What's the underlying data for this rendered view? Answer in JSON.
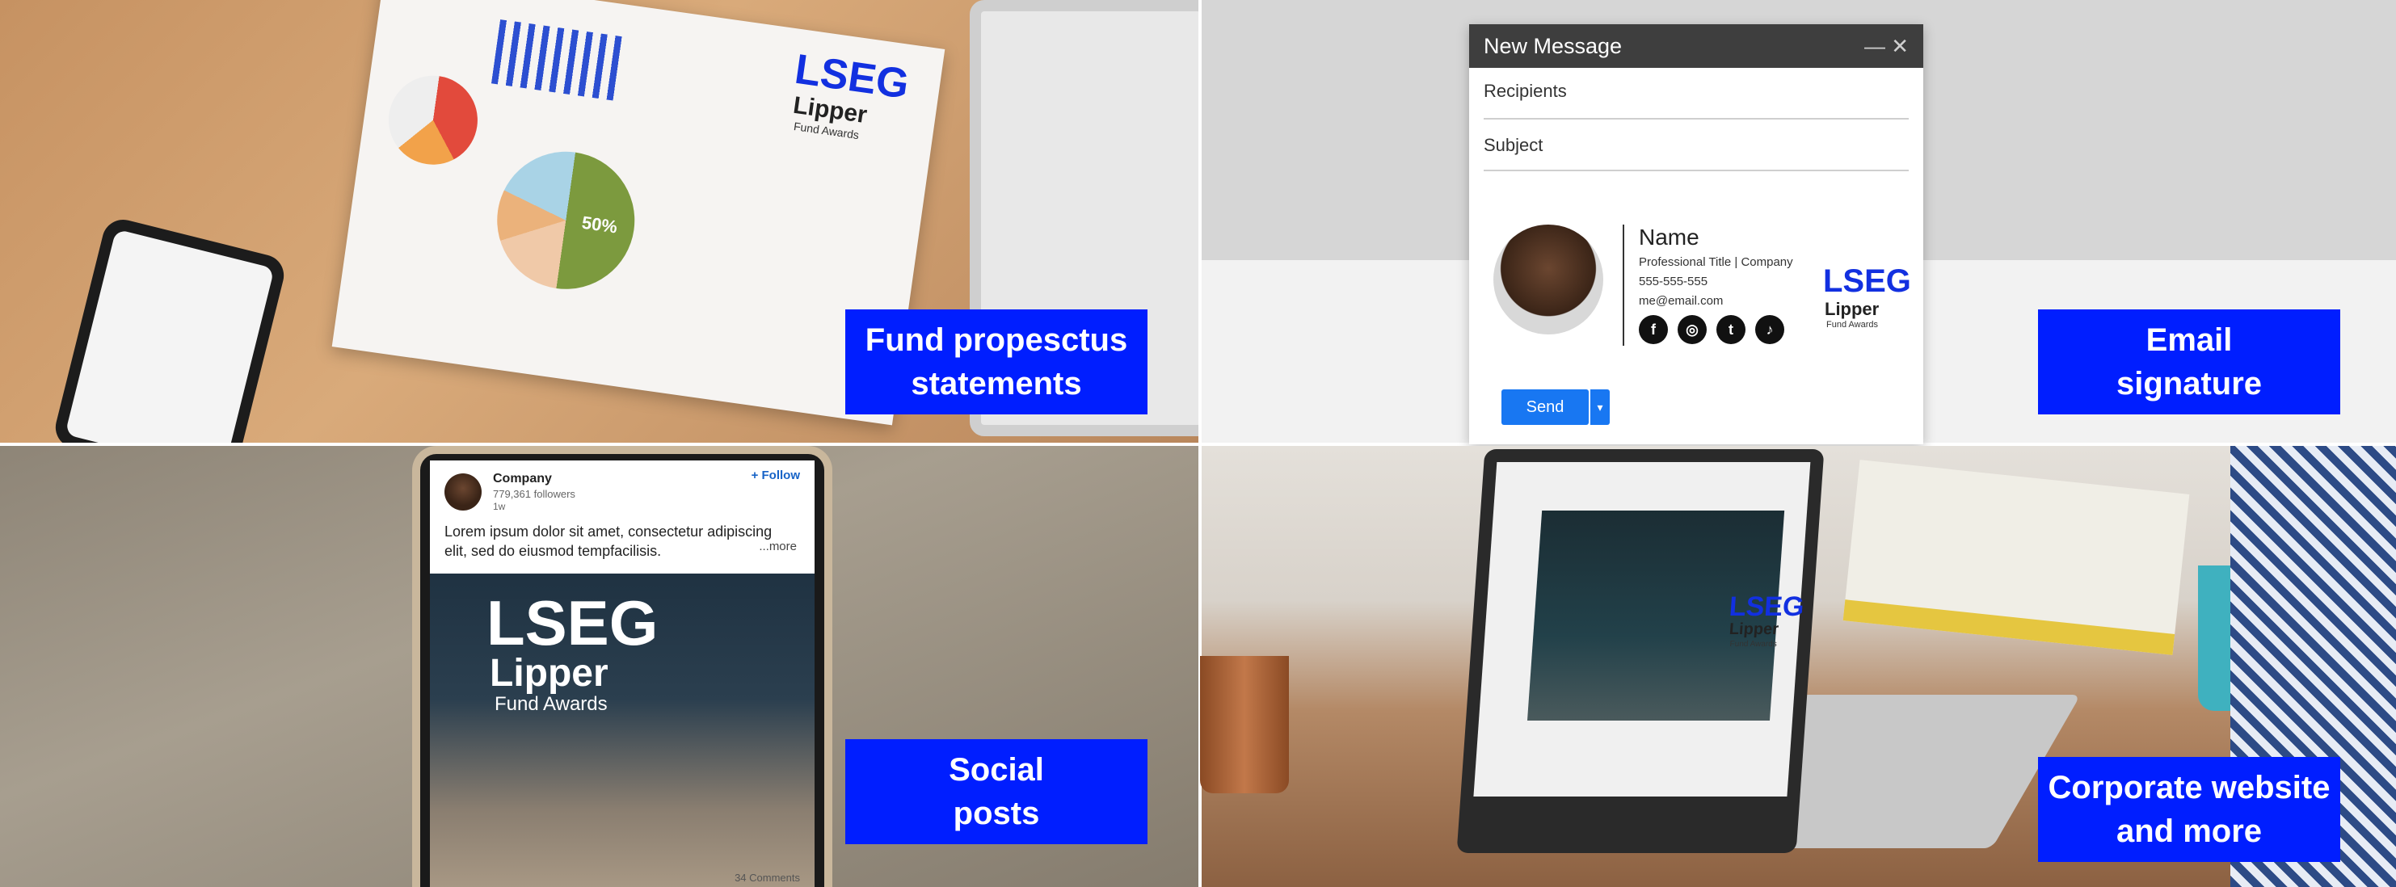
{
  "tiles": {
    "fund": {
      "label_line1": "Fund propesctus",
      "label_line2": "statements",
      "logo": {
        "brand": "LSEG",
        "sub": "Lipper",
        "sub2": "Fund Awards"
      },
      "chart_label": "50%"
    },
    "email": {
      "label_line1": "Email",
      "label_line2": "signature",
      "window_title": "New Message",
      "recipients_label": "Recipients",
      "subject_label": "Subject",
      "signature": {
        "name": "Name",
        "title_line": "Professional Title  |  Company",
        "phone": "555-555-555",
        "email": "me@email.com",
        "social_icons": [
          "facebook-icon",
          "instagram-icon",
          "twitter-icon",
          "tiktok-icon"
        ],
        "social_glyphs": [
          "f",
          "◎",
          "t",
          "♪"
        ]
      },
      "logo": {
        "brand": "LSEG",
        "sub": "Lipper",
        "sub2": "Fund Awards"
      },
      "send_label": "Send",
      "caret": "▾",
      "window_controls": "—  ✕"
    },
    "social": {
      "label_line1": "Social",
      "label_line2": "posts",
      "post": {
        "company": "Company",
        "followers": "779,361 followers",
        "time": "1w",
        "follow": "+ Follow",
        "text": "Lorem ipsum dolor sit amet, consectetur adipiscing elit, sed do eiusmod tempfacilisis.",
        "more": "...more",
        "comments": "34 Comments"
      },
      "logo": {
        "brand": "LSEG",
        "sub": "Lipper",
        "sub2": "Fund Awards"
      }
    },
    "website": {
      "label_line1": "Corporate website",
      "label_line2": "and more",
      "logo": {
        "brand": "LSEG",
        "sub": "Lipper",
        "sub2": "Fund Awards"
      }
    }
  },
  "colors": {
    "label_bg": "#001eff",
    "label_text": "#ffffff",
    "logo_blue": "#1230e0",
    "send_blue": "#1877f2"
  }
}
